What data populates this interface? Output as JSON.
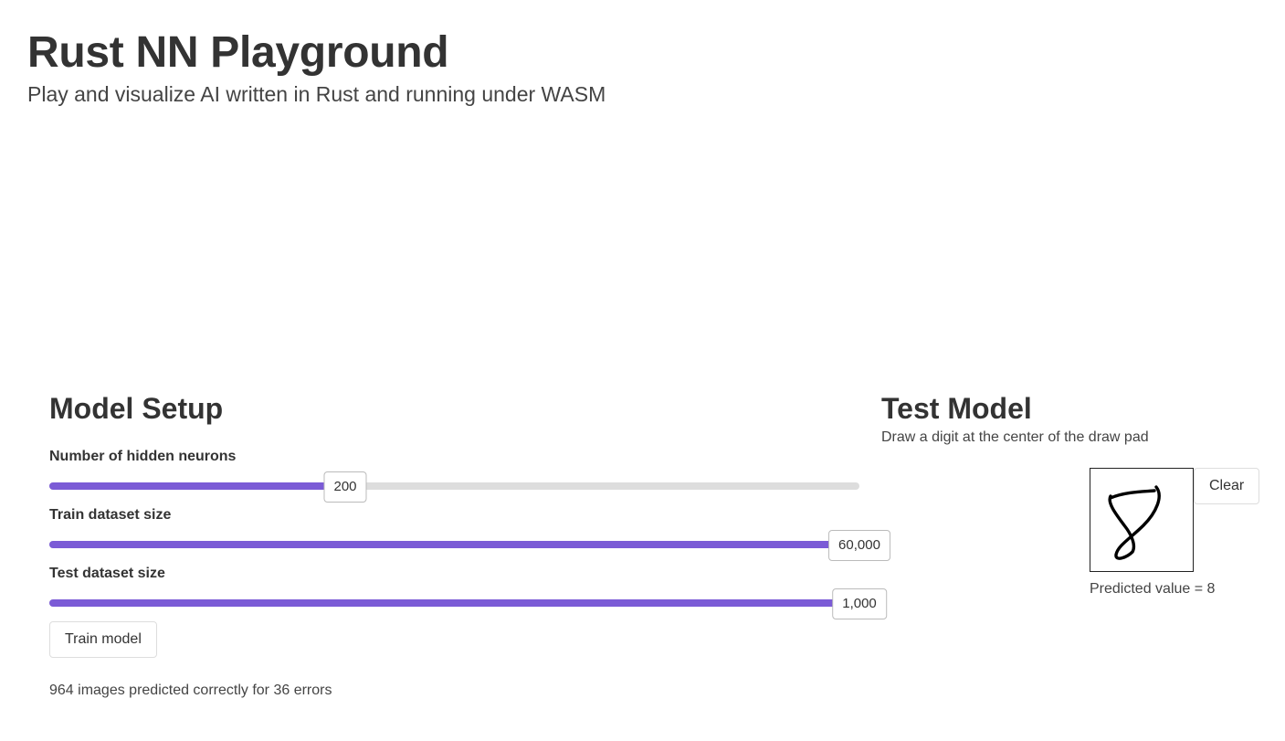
{
  "header": {
    "title": "Rust NN Playground",
    "subtitle": "Play and visualize AI written in Rust and running under WASM"
  },
  "model_setup": {
    "title": "Model Setup",
    "sliders": [
      {
        "label": "Number of hidden neurons",
        "value_text": "200",
        "fraction": 0.365
      },
      {
        "label": "Train dataset size",
        "value_text": "60,000",
        "fraction": 1.0
      },
      {
        "label": "Test dataset size",
        "value_text": "1,000",
        "fraction": 1.0
      }
    ],
    "train_button": "Train model",
    "result": "964 images predicted correctly for 36 errors"
  },
  "test_model": {
    "title": "Test Model",
    "instructions": "Draw a digit at the center of the draw pad",
    "clear_button": "Clear",
    "prediction": "Predicted value = 8"
  },
  "colors": {
    "accent": "#7b5bd6",
    "track": "#dddddd",
    "text": "#333333"
  }
}
